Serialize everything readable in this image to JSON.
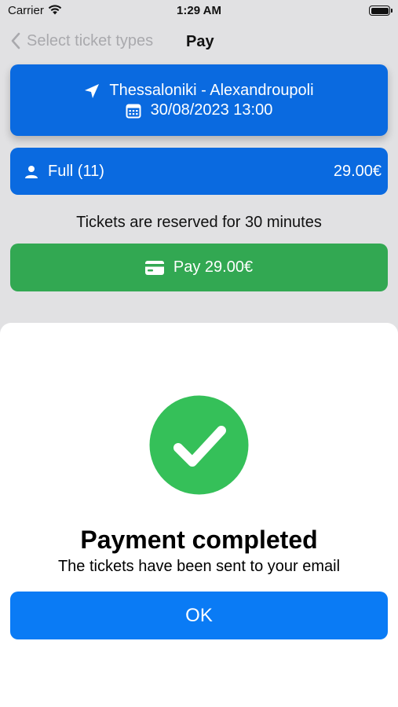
{
  "status_bar": {
    "carrier": "Carrier",
    "time": "1:29 AM"
  },
  "nav": {
    "back_label": "Select ticket types",
    "title": "Pay"
  },
  "route": {
    "name": "Thessaloniki - Alexandroupoli",
    "datetime": "30/08/2023 13:00"
  },
  "ticket": {
    "label": "Full (11)",
    "price": "29.00€"
  },
  "reservation_note": "Tickets are reserved for 30 minutes",
  "pay_button_label": "Pay 29.00€",
  "sheet": {
    "title": "Payment completed",
    "subtitle": "The tickets have been sent to your email",
    "ok_label": "OK"
  },
  "icons": [
    "wifi-icon",
    "battery-icon",
    "chevron-left-icon",
    "location-arrow-icon",
    "calendar-icon",
    "person-icon",
    "credit-card-icon",
    "checkmark-circle-icon"
  ],
  "colors": {
    "primary_blue": "#0a6ae0",
    "ok_blue": "#0a7bf5",
    "pay_green": "#32a852",
    "success_green": "#35c059",
    "background": "#e1e1e3"
  }
}
